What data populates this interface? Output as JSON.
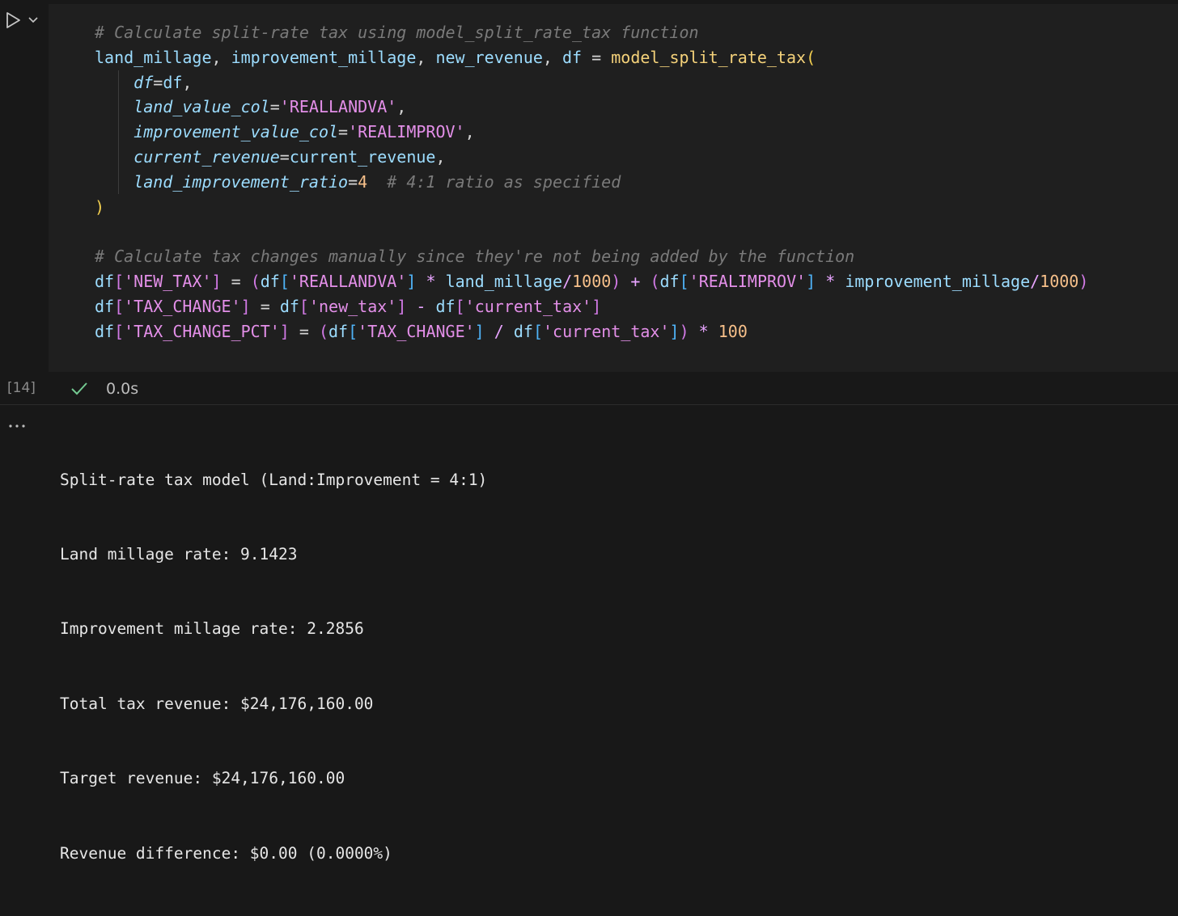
{
  "cell": {
    "execution_count": "[14]",
    "status": {
      "time": "0.0s",
      "icon": "check-icon",
      "color": "#73c991"
    },
    "code_lines": [
      [
        {
          "t": "# Calculate split-rate tax using model_split_rate_tax function",
          "k": "c"
        }
      ],
      [
        {
          "t": "land_millage",
          "k": "v"
        },
        {
          "t": ", ",
          "k": "d"
        },
        {
          "t": "improvement_millage",
          "k": "v"
        },
        {
          "t": ", ",
          "k": "d"
        },
        {
          "t": "new_revenue",
          "k": "v"
        },
        {
          "t": ", ",
          "k": "d"
        },
        {
          "t": "df",
          "k": "v"
        },
        {
          "t": " = ",
          "k": "d"
        },
        {
          "t": "model_split_rate_tax",
          "k": "f"
        },
        {
          "t": "(",
          "k": "b1"
        }
      ],
      [
        {
          "t": "    ",
          "k": "d"
        },
        {
          "t": "df",
          "k": "p"
        },
        {
          "t": "=",
          "k": "d"
        },
        {
          "t": "df",
          "k": "v"
        },
        {
          "t": ",",
          "k": "d"
        }
      ],
      [
        {
          "t": "    ",
          "k": "d"
        },
        {
          "t": "land_value_col",
          "k": "p"
        },
        {
          "t": "=",
          "k": "d"
        },
        {
          "t": "'REALLANDVA'",
          "k": "s"
        },
        {
          "t": ",",
          "k": "d"
        }
      ],
      [
        {
          "t": "    ",
          "k": "d"
        },
        {
          "t": "improvement_value_col",
          "k": "p"
        },
        {
          "t": "=",
          "k": "d"
        },
        {
          "t": "'REALIMPROV'",
          "k": "s"
        },
        {
          "t": ",",
          "k": "d"
        }
      ],
      [
        {
          "t": "    ",
          "k": "d"
        },
        {
          "t": "current_revenue",
          "k": "p"
        },
        {
          "t": "=",
          "k": "d"
        },
        {
          "t": "current_revenue",
          "k": "v"
        },
        {
          "t": ",",
          "k": "d"
        }
      ],
      [
        {
          "t": "    ",
          "k": "d"
        },
        {
          "t": "land_improvement_ratio",
          "k": "p"
        },
        {
          "t": "=",
          "k": "d"
        },
        {
          "t": "4",
          "k": "n"
        },
        {
          "t": "  ",
          "k": "d"
        },
        {
          "t": "# 4:1 ratio as specified",
          "k": "c"
        }
      ],
      [
        {
          "t": ")",
          "k": "b1"
        }
      ],
      [
        {
          "t": "",
          "k": "d"
        }
      ],
      [
        {
          "t": "# Calculate tax changes manually since they're not being added by the function",
          "k": "c"
        }
      ],
      [
        {
          "t": "df",
          "k": "v"
        },
        {
          "t": "[",
          "k": "b2"
        },
        {
          "t": "'NEW_TAX'",
          "k": "s"
        },
        {
          "t": "]",
          "k": "b2"
        },
        {
          "t": " = ",
          "k": "d"
        },
        {
          "t": "(",
          "k": "b2"
        },
        {
          "t": "df",
          "k": "v"
        },
        {
          "t": "[",
          "k": "b3"
        },
        {
          "t": "'REALLANDVA'",
          "k": "s"
        },
        {
          "t": "]",
          "k": "b3"
        },
        {
          "t": " ",
          "k": "d"
        },
        {
          "t": "*",
          "k": "o"
        },
        {
          "t": " ",
          "k": "d"
        },
        {
          "t": "land_millage",
          "k": "v"
        },
        {
          "t": "/",
          "k": "o"
        },
        {
          "t": "1000",
          "k": "n"
        },
        {
          "t": ")",
          "k": "b2"
        },
        {
          "t": " ",
          "k": "d"
        },
        {
          "t": "+",
          "k": "o"
        },
        {
          "t": " ",
          "k": "d"
        },
        {
          "t": "(",
          "k": "b2"
        },
        {
          "t": "df",
          "k": "v"
        },
        {
          "t": "[",
          "k": "b3"
        },
        {
          "t": "'REALIMPROV'",
          "k": "s"
        },
        {
          "t": "]",
          "k": "b3"
        },
        {
          "t": " ",
          "k": "d"
        },
        {
          "t": "*",
          "k": "o"
        },
        {
          "t": " ",
          "k": "d"
        },
        {
          "t": "improvement_millage",
          "k": "v"
        },
        {
          "t": "/",
          "k": "o"
        },
        {
          "t": "1000",
          "k": "n"
        },
        {
          "t": ")",
          "k": "b2"
        }
      ],
      [
        {
          "t": "df",
          "k": "v"
        },
        {
          "t": "[",
          "k": "b2"
        },
        {
          "t": "'TAX_CHANGE'",
          "k": "s"
        },
        {
          "t": "]",
          "k": "b2"
        },
        {
          "t": " = ",
          "k": "d"
        },
        {
          "t": "df",
          "k": "v"
        },
        {
          "t": "[",
          "k": "b2"
        },
        {
          "t": "'new_tax'",
          "k": "s"
        },
        {
          "t": "]",
          "k": "b2"
        },
        {
          "t": " ",
          "k": "d"
        },
        {
          "t": "-",
          "k": "o"
        },
        {
          "t": " ",
          "k": "d"
        },
        {
          "t": "df",
          "k": "v"
        },
        {
          "t": "[",
          "k": "b2"
        },
        {
          "t": "'current_tax'",
          "k": "s"
        },
        {
          "t": "]",
          "k": "b2"
        }
      ],
      [
        {
          "t": "df",
          "k": "v"
        },
        {
          "t": "[",
          "k": "b2"
        },
        {
          "t": "'TAX_CHANGE_PCT'",
          "k": "s"
        },
        {
          "t": "]",
          "k": "b2"
        },
        {
          "t": " = ",
          "k": "d"
        },
        {
          "t": "(",
          "k": "b2"
        },
        {
          "t": "df",
          "k": "v"
        },
        {
          "t": "[",
          "k": "b3"
        },
        {
          "t": "'TAX_CHANGE'",
          "k": "s"
        },
        {
          "t": "]",
          "k": "b3"
        },
        {
          "t": " ",
          "k": "d"
        },
        {
          "t": "/",
          "k": "o"
        },
        {
          "t": " ",
          "k": "d"
        },
        {
          "t": "df",
          "k": "v"
        },
        {
          "t": "[",
          "k": "b3"
        },
        {
          "t": "'current_tax'",
          "k": "s"
        },
        {
          "t": "]",
          "k": "b3"
        },
        {
          "t": ")",
          "k": "b2"
        },
        {
          "t": " ",
          "k": "d"
        },
        {
          "t": "*",
          "k": "o"
        },
        {
          "t": " ",
          "k": "d"
        },
        {
          "t": "100",
          "k": "n"
        }
      ]
    ]
  },
  "output": {
    "menu_label": "···",
    "lines": [
      "Split-rate tax model (Land:Improvement = 4:1)",
      "Land millage rate: 9.1423",
      "Improvement millage rate: 2.2856",
      "Total tax revenue: $24,176,160.00",
      "Target revenue: $24,176,160.00",
      "Revenue difference: $0.00 (0.0000%)"
    ]
  }
}
